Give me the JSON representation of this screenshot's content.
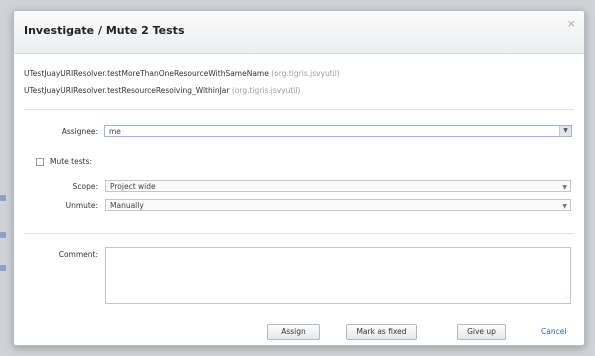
{
  "dialog": {
    "title": "Investigate / Mute 2 Tests",
    "tests": [
      {
        "name": "UTestJuayURIResolver.testMoreThanOneResourceWithSameName",
        "package": "(org.tigris.jsvyutil)"
      },
      {
        "name": "UTestJuayURIResolver.testResourceResolving_WithinJar",
        "package": "(org.tigris.jsvyutil)"
      }
    ],
    "assignee": {
      "label": "Assignee:",
      "value": "me"
    },
    "mute": {
      "label": "Mute tests:",
      "checked": false
    },
    "scope": {
      "label": "Scope:",
      "value": "Project wide"
    },
    "unmute": {
      "label": "Unmute:",
      "value": "Manually"
    },
    "comment": {
      "label": "Comment:",
      "value": ""
    },
    "buttons": {
      "assign": "Assign",
      "fixed": "Mark as fixed",
      "giveup": "Give up",
      "cancel": "Cancel"
    }
  }
}
